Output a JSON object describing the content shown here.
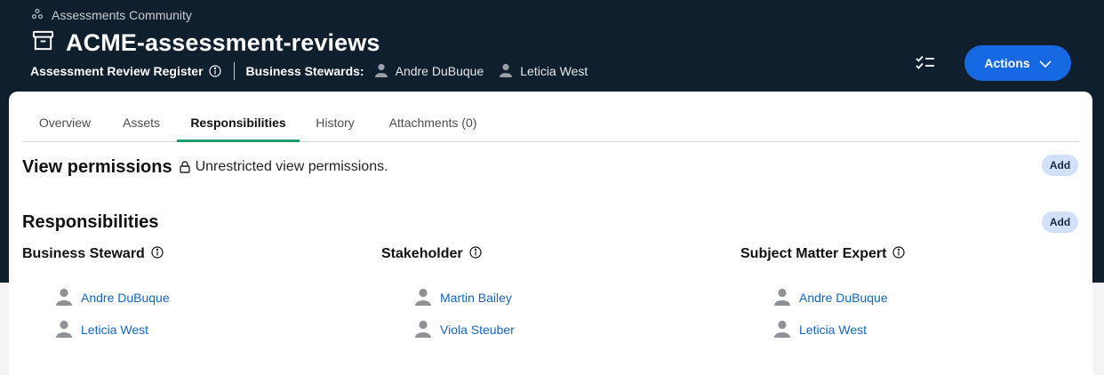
{
  "breadcrumb": {
    "label": "Assessments Community"
  },
  "page": {
    "title": "ACME-assessment-reviews",
    "type_label": "Assessment Review Register",
    "stewards_label": "Business Stewards:",
    "stewards": [
      "Andre DuBuque",
      "Leticia West"
    ]
  },
  "actions": {
    "label": "Actions"
  },
  "tabs": [
    {
      "label": "Overview"
    },
    {
      "label": "Assets"
    },
    {
      "label": "Responsibilities",
      "active": true
    },
    {
      "label": "History"
    },
    {
      "label": "Attachments (0)"
    }
  ],
  "view_permissions": {
    "title": "View permissions",
    "text": "Unrestricted view permissions.",
    "add_label": "Add"
  },
  "responsibilities": {
    "title": "Responsibilities",
    "add_label": "Add",
    "roles": [
      {
        "name": "Business Steward",
        "people": [
          "Andre DuBuque",
          "Leticia West"
        ]
      },
      {
        "name": "Stakeholder",
        "people": [
          "Martin Bailey",
          "Viola Steuber"
        ]
      },
      {
        "name": "Subject Matter Expert",
        "people": [
          "Andre DuBuque",
          "Leticia West"
        ]
      }
    ]
  },
  "colors": {
    "header_bg": "#0f1f2d",
    "accent": "#1668e3",
    "active_tab": "#1f9d6b",
    "link": "#1565c0"
  }
}
